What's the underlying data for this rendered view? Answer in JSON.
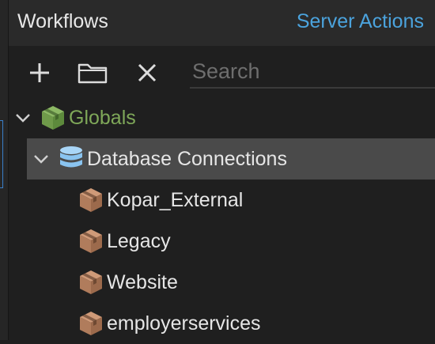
{
  "header": {
    "title": "Workflows",
    "server_actions": "Server Actions"
  },
  "toolbar": {
    "add_icon": "plus-icon",
    "folder_icon": "folder-icon",
    "close_icon": "close-icon",
    "search_placeholder": "Search",
    "search_value": ""
  },
  "tree": {
    "globals": {
      "label": "Globals",
      "icon": "package-icon",
      "expanded": true,
      "color": "#7fa859"
    },
    "database_connections": {
      "label": "Database Connections",
      "icon": "database-icon",
      "expanded": true,
      "selected": true,
      "color": "#8ac4f0"
    },
    "connections": [
      {
        "label": "Kopar_External",
        "icon": "package-icon",
        "color": "#c08a68"
      },
      {
        "label": "Legacy",
        "icon": "package-icon",
        "color": "#c08a68"
      },
      {
        "label": "Website",
        "icon": "package-icon",
        "color": "#c08a68"
      },
      {
        "label": "employerservices",
        "icon": "package-icon",
        "color": "#c08a68"
      }
    ]
  }
}
